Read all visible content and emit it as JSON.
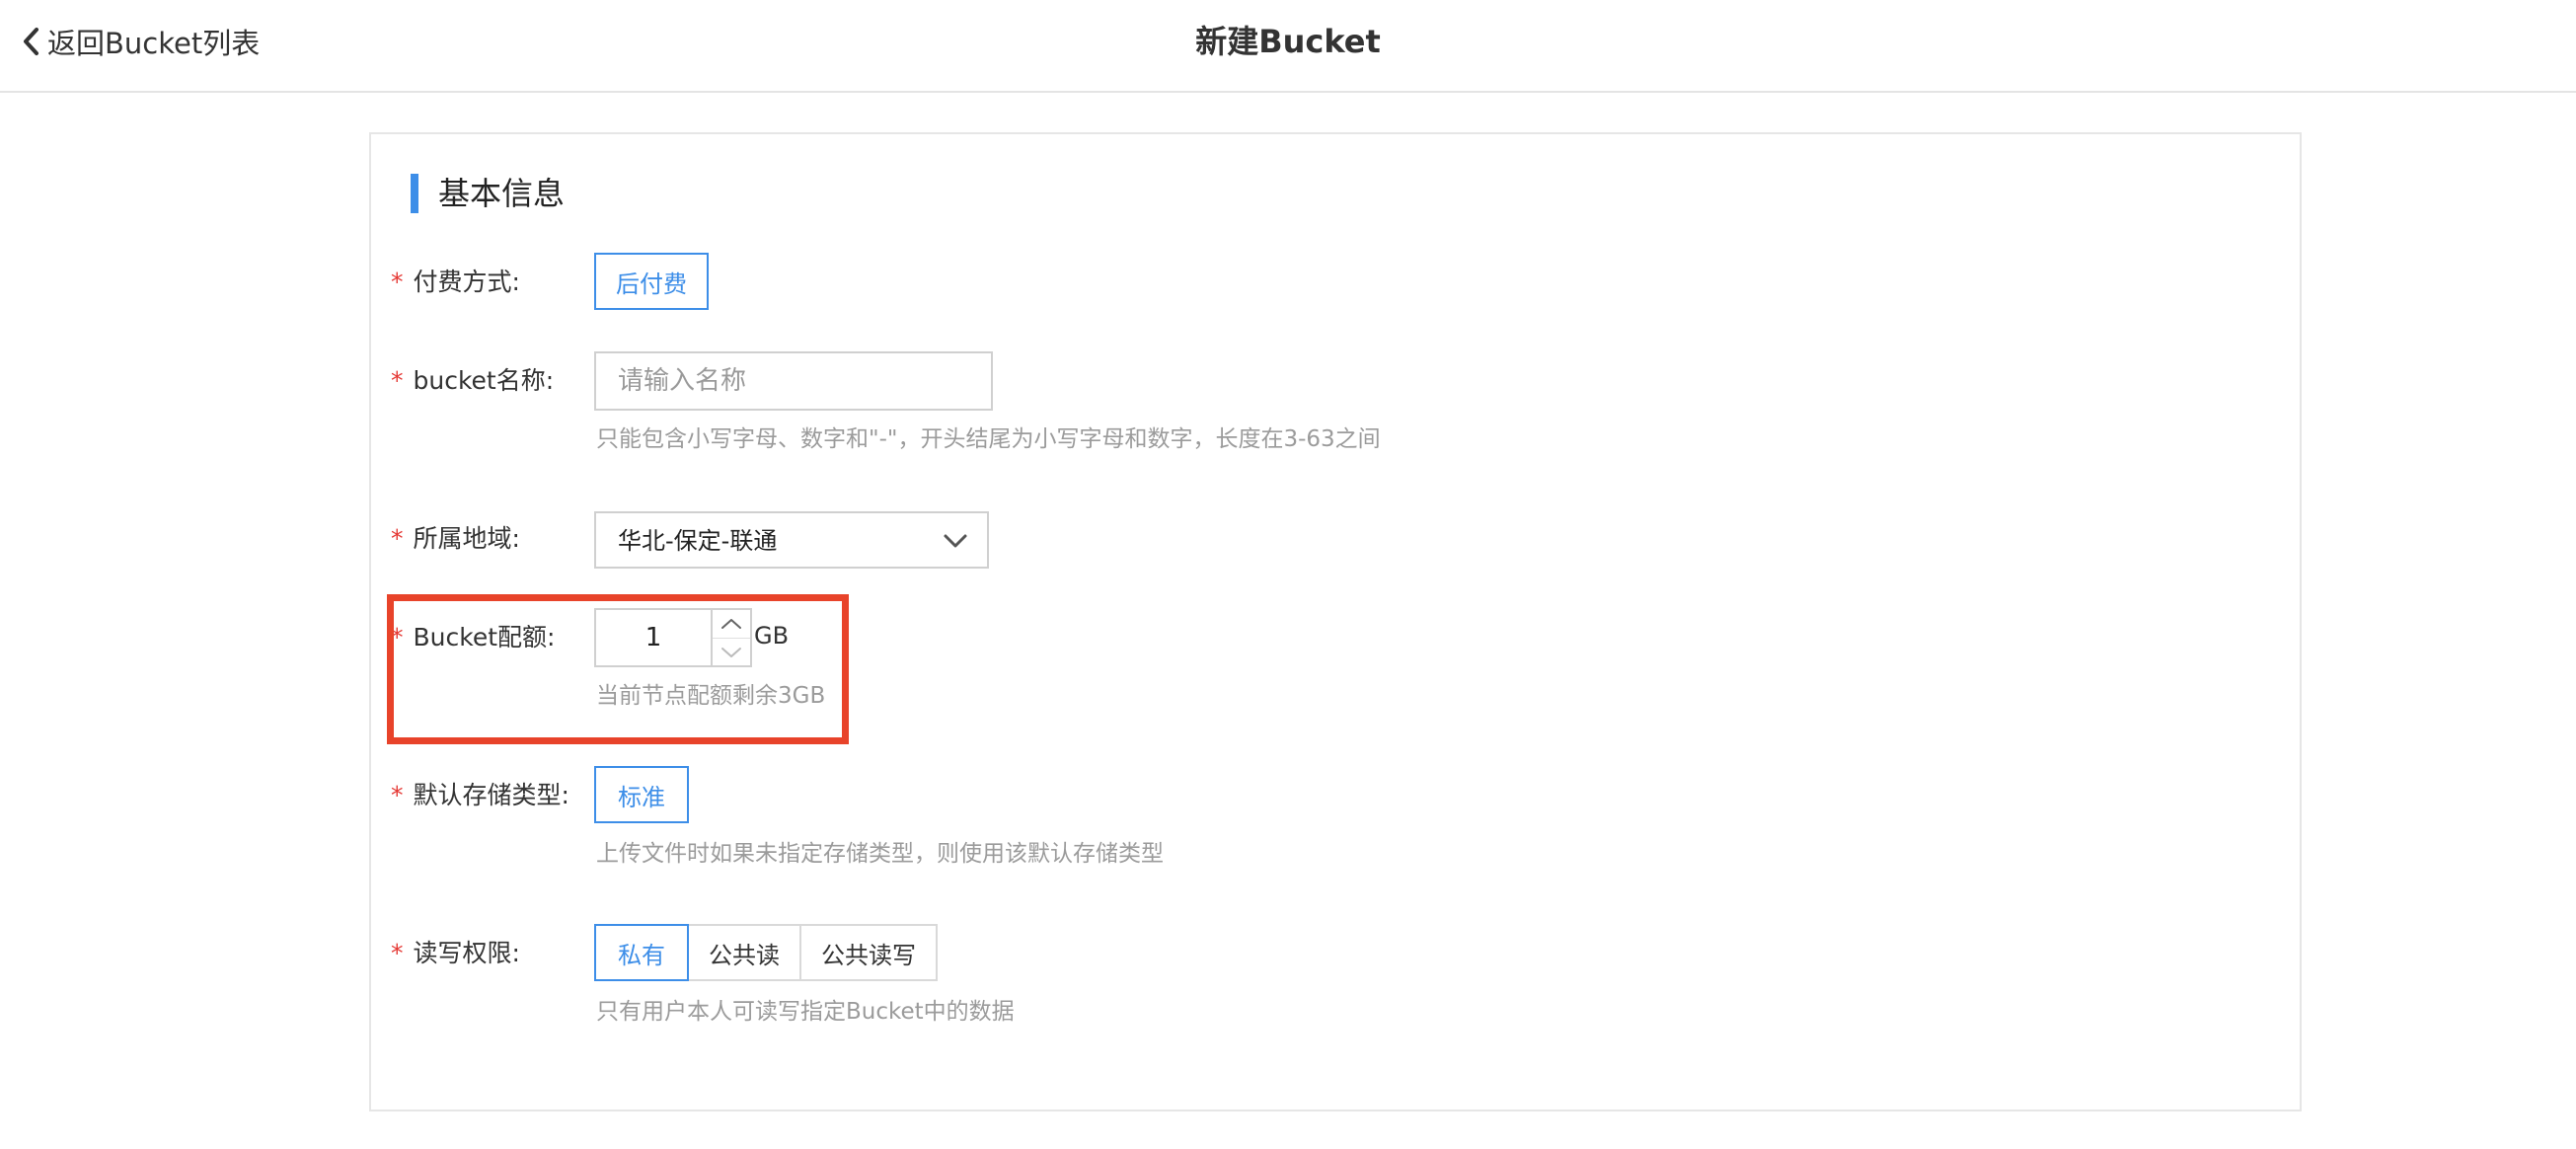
{
  "header": {
    "back_label": "返回Bucket列表",
    "title": "新建Bucket"
  },
  "section": {
    "title": "基本信息"
  },
  "colors": {
    "accent": "#3d8ee8",
    "required_star": "#e53935",
    "highlight_border": "#e8432a"
  },
  "form": {
    "required_mark": "*",
    "payment": {
      "label": "付费方式:",
      "option": "后付费"
    },
    "bucket_name": {
      "label": "bucket名称:",
      "placeholder": "请输入名称",
      "value": "",
      "hint": "只能包含小写字母、数字和\"-\"，开头结尾为小写字母和数字，长度在3-63之间"
    },
    "region": {
      "label": "所属地域:",
      "selected": "华北-保定-联通"
    },
    "quota": {
      "label": "Bucket配额:",
      "value": "1",
      "unit": "GB",
      "hint": "当前节点配额剩余3GB"
    },
    "storage_type": {
      "label": "默认存储类型:",
      "option": "标准",
      "hint": "上传文件时如果未指定存储类型，则使用该默认存储类型"
    },
    "permission": {
      "label": "读写权限:",
      "options": [
        "私有",
        "公共读",
        "公共读写"
      ],
      "selected": "私有",
      "hint": "只有用户本人可读写指定Bucket中的数据"
    }
  }
}
